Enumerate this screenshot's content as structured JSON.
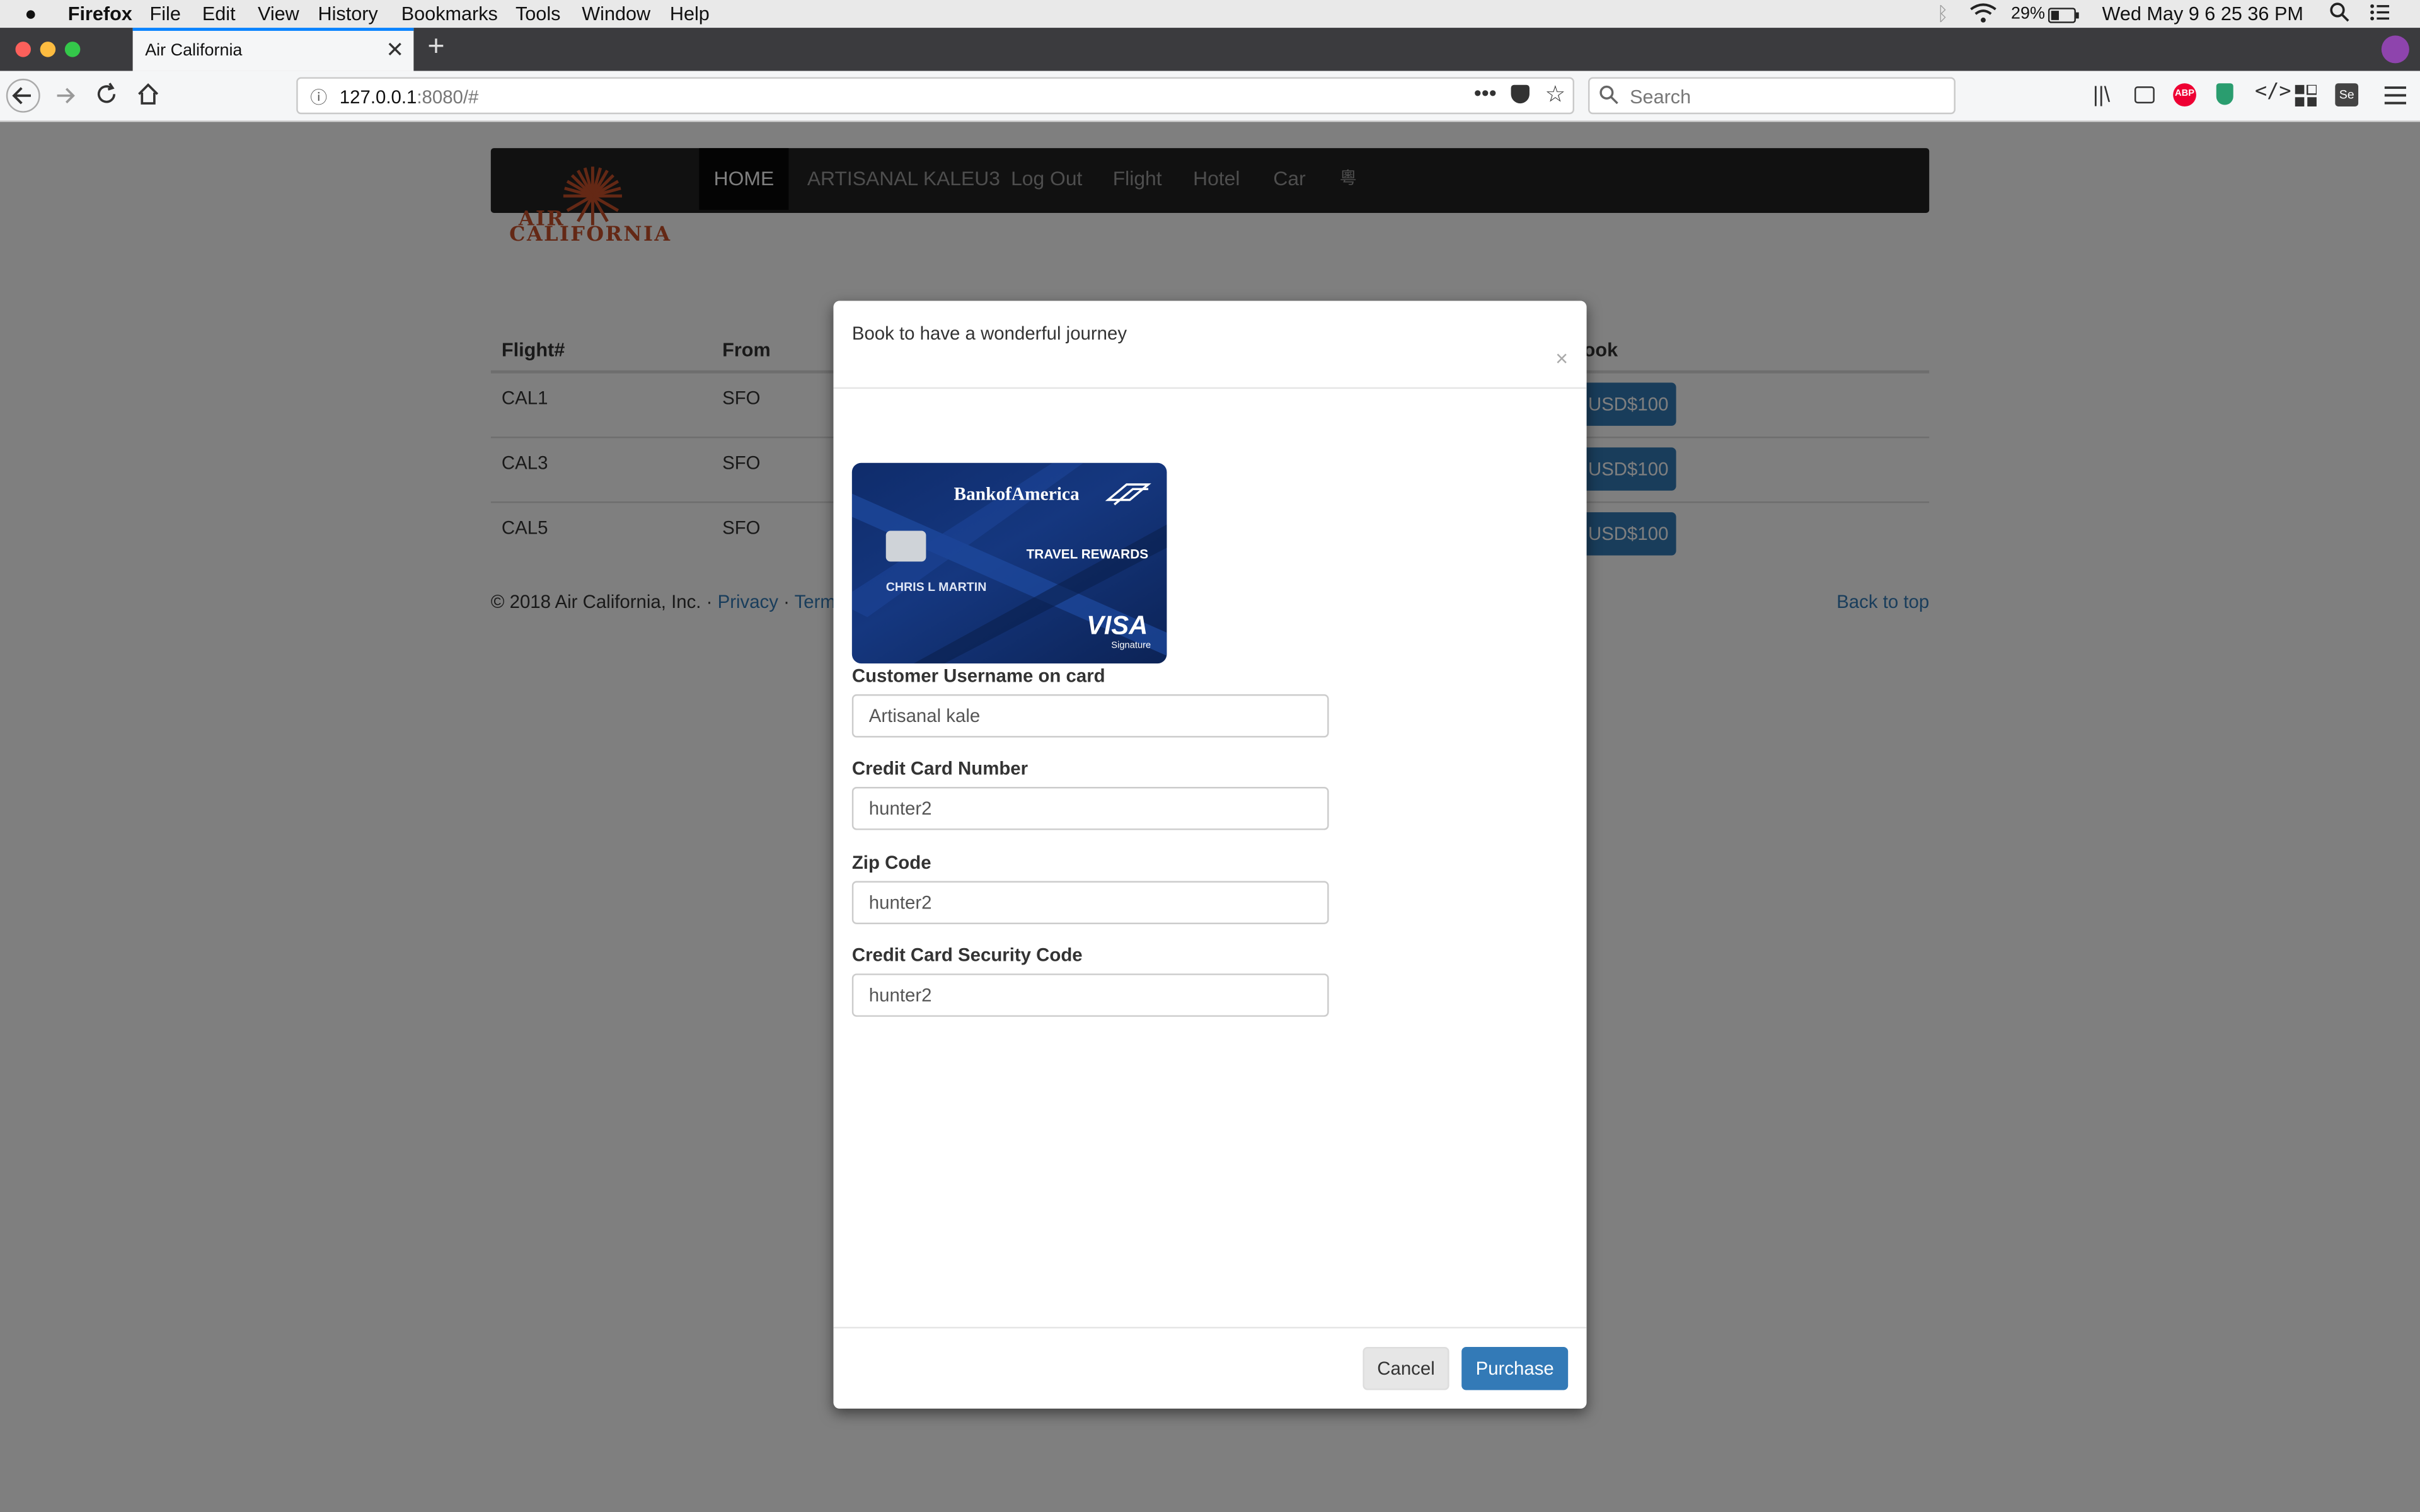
{
  "menubar": {
    "app": "Firefox",
    "menus": [
      "File",
      "Edit",
      "View",
      "History",
      "Bookmarks",
      "Tools",
      "Window",
      "Help"
    ],
    "battery": "29%",
    "clock": "Wed May 9  6 25 36 PM"
  },
  "browser": {
    "tab_title": "Air California",
    "url_host": "127.0.0.1",
    "url_rest": ":8080/#",
    "search_placeholder": "Search"
  },
  "site": {
    "logo_line1": "AIR",
    "logo_line2": "CALIFORNIA",
    "nav": [
      "HOME",
      "ARTISANAL KALEU3",
      "Log Out",
      "Flight",
      "Hotel",
      "Car",
      "粵"
    ],
    "table": {
      "headers": [
        "Flight#",
        "From",
        "ook"
      ],
      "rows": [
        {
          "flight": "CAL1",
          "from": "SFO",
          "price": "USD$100"
        },
        {
          "flight": "CAL3",
          "from": "SFO",
          "price": "USD$100"
        },
        {
          "flight": "CAL5",
          "from": "SFO",
          "price": "USD$100"
        }
      ]
    },
    "footer": {
      "copyright": "© 2018 Air California, Inc. ·",
      "privacy": "Privacy",
      "sep": "·",
      "terms": "Terms",
      "back_to_top": "Back to top"
    }
  },
  "modal": {
    "title": "Book to have a wonderful journey",
    "close": "×",
    "card": {
      "bank": "BankofAmerica",
      "product": "TRAVEL REWARDS",
      "holder": "CHRIS L MARTIN",
      "network": "VISA",
      "network_sub": "Signature"
    },
    "fields": [
      {
        "label": "Customer Username on card",
        "value": "Artisanal kale"
      },
      {
        "label": "Credit Card Number",
        "value": "hunter2"
      },
      {
        "label": "Zip Code",
        "value": "hunter2"
      },
      {
        "label": "Credit Card Security Code",
        "value": "hunter2"
      }
    ],
    "cancel": "Cancel",
    "purchase": "Purchase"
  }
}
